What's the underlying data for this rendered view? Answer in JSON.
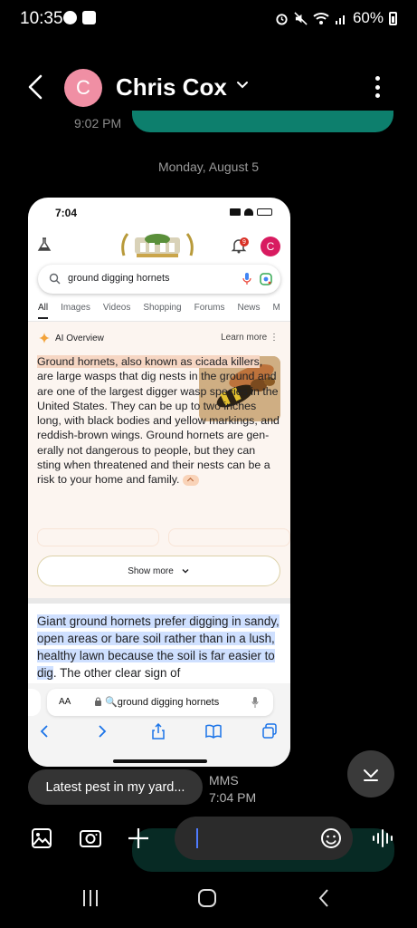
{
  "status_bar": {
    "time": "10:35",
    "battery": "60%",
    "icons": [
      "chat-icon",
      "app-icon",
      "alarm-icon",
      "mute-icon",
      "wifi-icon",
      "signal-icon",
      "battery-icon"
    ]
  },
  "header": {
    "avatar_letter": "C",
    "contact_name": "Chris Cox",
    "accent": "#f08fa4"
  },
  "conversation": {
    "prev_time": "9:02 PM",
    "date_separator": "Monday, August 5"
  },
  "screenshot": {
    "time": "7:04",
    "notification_count": "9",
    "avatar_letter": "C",
    "search_query": "ground digging hornets",
    "tabs": [
      "All",
      "Images",
      "Videos",
      "Shopping",
      "Forums",
      "News",
      "M"
    ],
    "ai_overview": {
      "title": "AI Overview",
      "learn_more": "Learn more",
      "highlight": "Ground hornets, also known as cicada killers",
      "body": ", are large wasps that dig nests in the ground and are one of the largest digger wasp species in the United States. They can be up to two inches long, with black bodies and yellow markings, and reddish-brown wings. Ground hornets are gen­erally not dangerous to people, but they can sting when threatened and their nests can be a risk to your home and family.",
      "show_more": "Show more"
    },
    "snippet": {
      "highlight": "Giant ground hornets prefer digging in sandy, open areas or bare soil rather than in a lush, healthy lawn because the soil is far easier to dig",
      "rest": ". The other clear sign of"
    },
    "toolbar": {
      "aa": "AA",
      "url": "ground digging hornets"
    }
  },
  "message": {
    "text": "Latest pest in my yard...",
    "type": "MMS",
    "time": "7:04 PM"
  },
  "composer": {
    "input_value": ""
  }
}
